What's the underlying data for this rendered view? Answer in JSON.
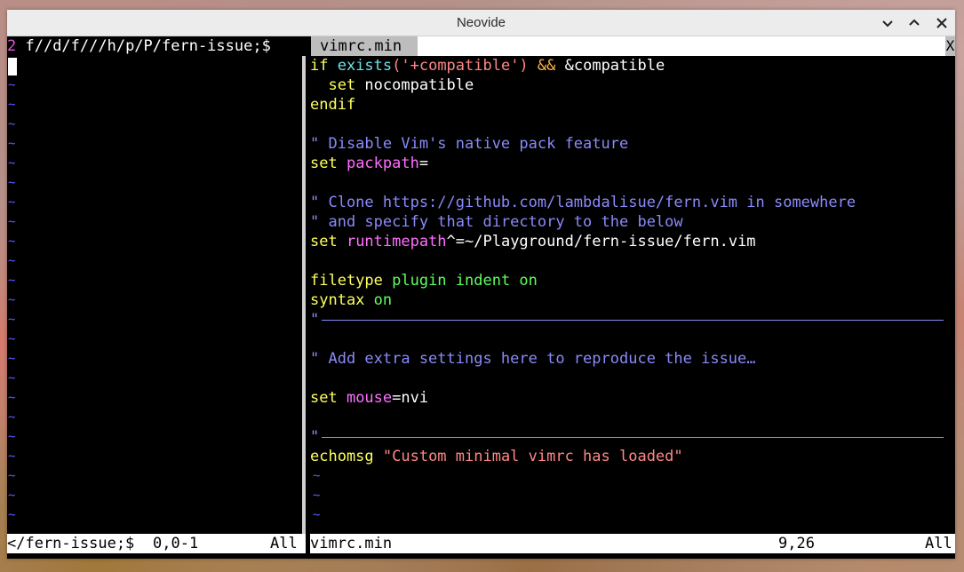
{
  "window": {
    "title": "Neovide"
  },
  "tabline": {
    "inactive_num": "2",
    "inactive_label": " f//d/f///h/p/P/fern-issue;$ ",
    "active_label": "vimrc.min",
    "close_label": "X"
  },
  "left_pane": {
    "tilde": "~"
  },
  "code": {
    "l1_kw": "if ",
    "l1_fn": "exists",
    "l1_str": "('+compatible')",
    "l1_op": " && ",
    "l1_rest": "&compatible",
    "l2_kw": "  set ",
    "l2_rest": "nocompatible",
    "l3_kw": "endif",
    "l5_comment": "\" Disable Vim's native pack feature",
    "l6_kw": "set ",
    "l6_opt": "packpath",
    "l6_rest": "=",
    "l8_comment": "\" Clone https://github.com/lambdalisue/fern.vim in somewhere",
    "l9_comment": "\" and specify that directory to the below",
    "l10_kw": "set ",
    "l10_opt": "runtimepath",
    "l10_rest": "^=~/Playground/fern-issue/fern.vim",
    "l12_kw": "filetype ",
    "l12_rest": "plugin indent on",
    "l13_kw": "syntax ",
    "l13_rest": "on",
    "l14_quote": "\"",
    "l16_comment": "\" Add extra settings here to reproduce the issue…",
    "l18_kw": "set ",
    "l18_opt": "mouse",
    "l18_rest": "=nvi",
    "l20_quote": "\"",
    "l21_kw": "echomsg ",
    "l21_str": "\"Custom minimal vimrc has loaded\""
  },
  "status": {
    "left_file": "</fern-issue;$",
    "left_pos": "0,0-1",
    "left_scroll": "All",
    "right_file": "vimrc.min",
    "right_pos": "9,26",
    "right_scroll": "All"
  },
  "colors": {
    "keyword": "#ffff5f",
    "function": "#6fe0e8",
    "string": "#ff8787",
    "comment": "#8a8afa",
    "option": "#ff6eff",
    "green": "#5fff5f",
    "tilde": "#5c5cff"
  }
}
